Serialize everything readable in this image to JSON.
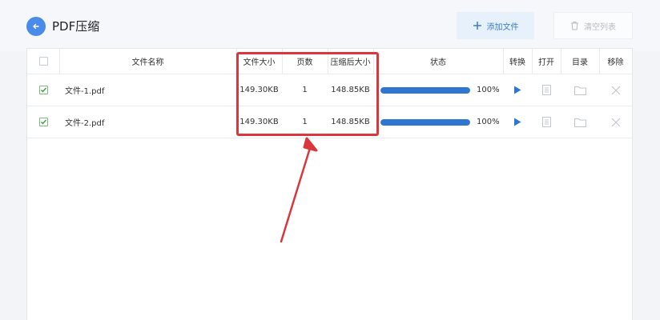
{
  "app": {
    "title": "PDF压缩"
  },
  "toolbar": {
    "add_label": "添加文件",
    "clear_label": "清空列表"
  },
  "table": {
    "headers": {
      "name": "文件名称",
      "size": "文件大小",
      "pages": "页数",
      "compressed": "压缩后大小",
      "status": "状态",
      "convert": "转换",
      "open": "打开",
      "folder": "目录",
      "remove": "移除"
    },
    "rows": [
      {
        "checked": true,
        "name": "文件-1.pdf",
        "size": "149.30KB",
        "pages": "1",
        "compressed": "148.85KB",
        "progress": 100,
        "progress_label": "100%"
      },
      {
        "checked": true,
        "name": "文件-2.pdf",
        "size": "149.30KB",
        "pages": "1",
        "compressed": "148.85KB",
        "progress": 100,
        "progress_label": "100%"
      }
    ]
  },
  "colors": {
    "accent": "#2f76d2",
    "highlight": "#d9363e",
    "check": "#3aa13a"
  },
  "icons": [
    "arrow-left-icon",
    "plus-icon",
    "trash-icon",
    "play-icon",
    "document-icon",
    "folder-icon",
    "close-icon",
    "checkmark-icon"
  ]
}
